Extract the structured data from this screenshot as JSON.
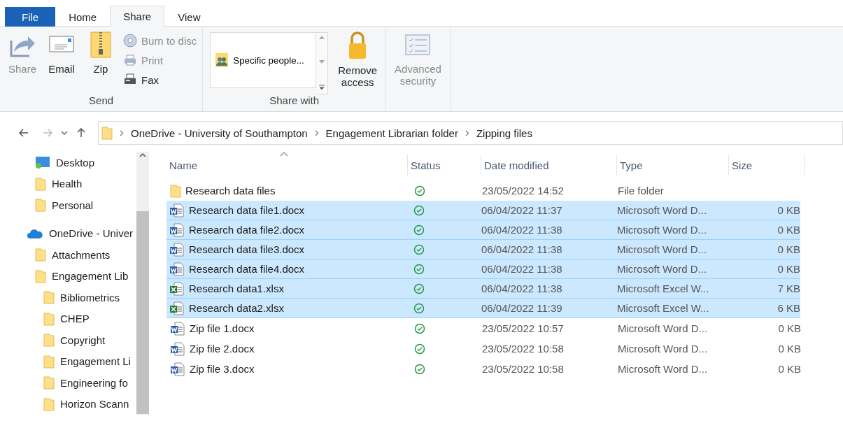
{
  "tabs": [
    {
      "label": "File",
      "kind": "file",
      "selected": false
    },
    {
      "label": "Home",
      "kind": "tab",
      "selected": false
    },
    {
      "label": "Share",
      "kind": "tab",
      "selected": true
    },
    {
      "label": "View",
      "kind": "tab",
      "selected": false
    }
  ],
  "ribbon": {
    "groups": [
      {
        "label": "Send",
        "commands": [
          {
            "label": "Share",
            "kind": "large",
            "disabled": true
          },
          {
            "label": "Email",
            "kind": "large",
            "disabled": false
          },
          {
            "label": "Zip",
            "kind": "large",
            "disabled": false
          },
          {
            "kind": "stack",
            "items": [
              {
                "label": "Burn to disc",
                "disabled": true
              },
              {
                "label": "Print",
                "disabled": true
              },
              {
                "label": "Fax",
                "disabled": false
              }
            ]
          }
        ]
      },
      {
        "label": "Share with",
        "commands": [
          {
            "kind": "gallery",
            "label": "Specific people..."
          },
          {
            "label": "Remove access",
            "kind": "large",
            "disabled": false
          }
        ]
      },
      {
        "commands": [
          {
            "label": "Advanced security",
            "kind": "large",
            "disabled": true
          }
        ]
      }
    ]
  },
  "nav": {
    "back_disabled": false,
    "forward_disabled": true
  },
  "address": {
    "segments": [
      "OneDrive - University of Southampton",
      "Engagement Librarian folder",
      "Zipping files"
    ]
  },
  "sidebar": {
    "items": [
      {
        "label": "Desktop",
        "kind": "desktop"
      },
      {
        "label": "Health",
        "kind": "folder"
      },
      {
        "label": "Personal",
        "kind": "folder"
      },
      {
        "label": "OneDrive - Univer",
        "kind": "cloud",
        "children": [
          {
            "label": "Attachments",
            "kind": "folder"
          },
          {
            "label": "Engagement Lib",
            "kind": "folder",
            "children": [
              {
                "label": "Bibliometrics",
                "kind": "folder"
              },
              {
                "label": "CHEP",
                "kind": "folder"
              },
              {
                "label": "Copyright",
                "kind": "folder"
              },
              {
                "label": "Engagement Li",
                "kind": "folder"
              },
              {
                "label": "Engineering fo",
                "kind": "folder"
              },
              {
                "label": "Horizon Scann",
                "kind": "folder"
              }
            ]
          }
        ]
      }
    ]
  },
  "table": {
    "columns": [
      "Name",
      "Status",
      "Date modified",
      "Type",
      "Size"
    ],
    "rows": [
      {
        "name": "Research data files",
        "kind": "folder",
        "date": "23/05/2022 14:52",
        "type": "File folder",
        "size": "",
        "selected": false
      },
      {
        "name": "Research data file1.docx",
        "kind": "word",
        "date": "06/04/2022 11:37",
        "type": "Microsoft Word D...",
        "size": "0 KB",
        "selected": true
      },
      {
        "name": "Research data file2.docx",
        "kind": "word",
        "date": "06/04/2022 11:38",
        "type": "Microsoft Word D...",
        "size": "0 KB",
        "selected": true
      },
      {
        "name": "Research data file3.docx",
        "kind": "word",
        "date": "06/04/2022 11:38",
        "type": "Microsoft Word D...",
        "size": "0 KB",
        "selected": true
      },
      {
        "name": "Research data file4.docx",
        "kind": "word",
        "date": "06/04/2022 11:38",
        "type": "Microsoft Word D...",
        "size": "0 KB",
        "selected": true
      },
      {
        "name": "Research data1.xlsx",
        "kind": "excel",
        "date": "06/04/2022 11:38",
        "type": "Microsoft Excel W...",
        "size": "7 KB",
        "selected": true
      },
      {
        "name": "Research data2.xlsx",
        "kind": "excel",
        "date": "06/04/2022 11:39",
        "type": "Microsoft Excel W...",
        "size": "6 KB",
        "selected": true
      },
      {
        "name": "Zip file 1.docx",
        "kind": "word",
        "date": "23/05/2022 10:57",
        "type": "Microsoft Word D...",
        "size": "0 KB",
        "selected": false
      },
      {
        "name": "Zip file 2.docx",
        "kind": "word",
        "date": "23/05/2022 10:58",
        "type": "Microsoft Word D...",
        "size": "0 KB",
        "selected": false
      },
      {
        "name": "Zip file 3.docx",
        "kind": "word",
        "date": "23/05/2022 10:58",
        "type": "Microsoft Word D...",
        "size": "0 KB",
        "selected": false
      }
    ]
  }
}
